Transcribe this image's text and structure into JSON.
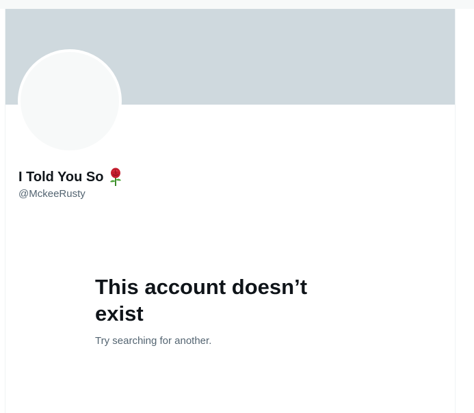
{
  "profile": {
    "display_name": "I Told You So",
    "name_emoji_icon": "rose-icon",
    "handle": "@MckeeRusty"
  },
  "empty_state": {
    "title": "This account doesn’t exist",
    "subtitle": "Try searching for another."
  },
  "colors": {
    "banner": "#cfd9de",
    "avatar_fill": "#f7f9f9",
    "primary_text": "#0f1419",
    "secondary_text": "#536471"
  }
}
